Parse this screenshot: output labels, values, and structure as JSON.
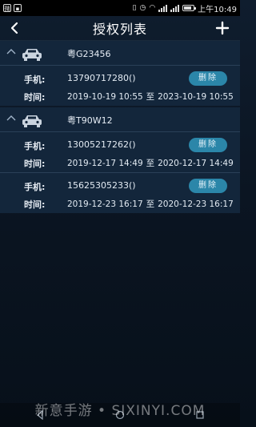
{
  "status_bar": {
    "app_icon": "微",
    "time": "上午10:49",
    "battery_level": 0.8
  },
  "header": {
    "title": "授权列表"
  },
  "groups": [
    {
      "plate": "粤G23456",
      "records": [
        {
          "phone_label": "手机:",
          "phone": "13790717280()",
          "time_label": "时间:",
          "start": "2019-10-19 10:55",
          "sep": "至",
          "end": "2023-10-19 10:55",
          "delete_label": "删除"
        }
      ]
    },
    {
      "plate": "粤T90W12",
      "records": [
        {
          "phone_label": "手机:",
          "phone": "13005217262()",
          "time_label": "时间:",
          "start": "2019-12-17 14:49",
          "sep": "至",
          "end": "2020-12-17 14:49",
          "delete_label": "删除"
        },
        {
          "phone_label": "手机:",
          "phone": "15625305233()",
          "time_label": "时间:",
          "start": "2019-12-23 16:17",
          "sep": "至",
          "end": "2020-12-23 16:17",
          "delete_label": "删除"
        }
      ]
    }
  ],
  "watermark": "新意手游 • SIXINYI.COM",
  "colors": {
    "background": "#0b1522",
    "card": "#13263b",
    "accent": "#2b86a9"
  }
}
